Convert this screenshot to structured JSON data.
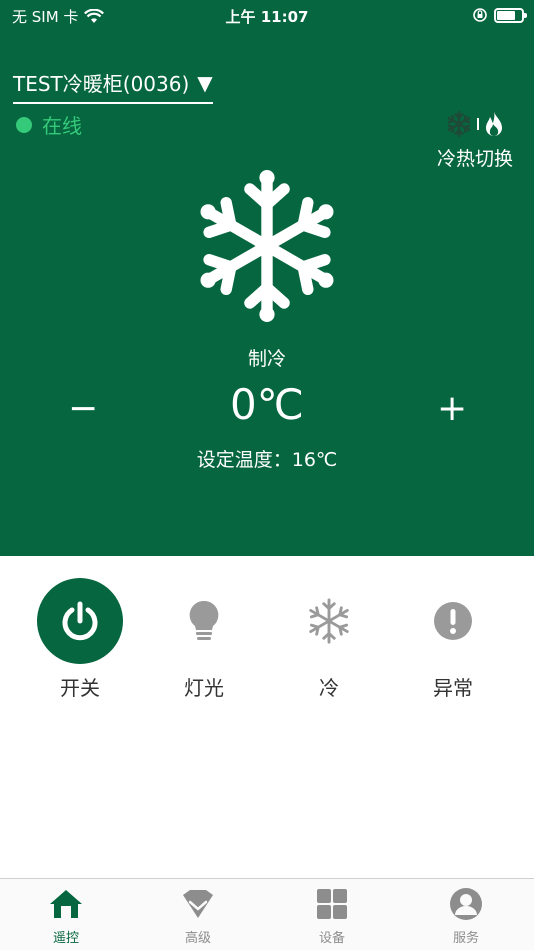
{
  "status_bar": {
    "carrier": "无 SIM 卡",
    "time": "上午 11:07"
  },
  "header": {
    "device_name": "TEST冷暖柜(0036)",
    "dropdown_glyph": "▼",
    "online_status": "在线",
    "switch_label": "冷热切换"
  },
  "climate": {
    "mode": "制冷",
    "current_temp": "0℃",
    "set_temp": "设定温度：16℃",
    "minus_label": "−",
    "plus_label": "+"
  },
  "controls": [
    {
      "label": "开关",
      "icon": "power-icon",
      "active": true
    },
    {
      "label": "灯光",
      "icon": "bulb-icon",
      "active": false
    },
    {
      "label": "冷",
      "icon": "snowflake-icon",
      "active": false
    },
    {
      "label": "异常",
      "icon": "alert-icon",
      "active": false
    }
  ],
  "tabs": [
    {
      "label": "遥控",
      "icon": "home-icon",
      "active": true
    },
    {
      "label": "高级",
      "icon": "diamond-icon",
      "active": false
    },
    {
      "label": "设备",
      "icon": "grid-icon",
      "active": false
    },
    {
      "label": "服务",
      "icon": "user-icon",
      "active": false
    }
  ],
  "colors": {
    "primary": "#05663f",
    "online": "#35c97a",
    "inactive_icon": "#9a9a9a"
  }
}
